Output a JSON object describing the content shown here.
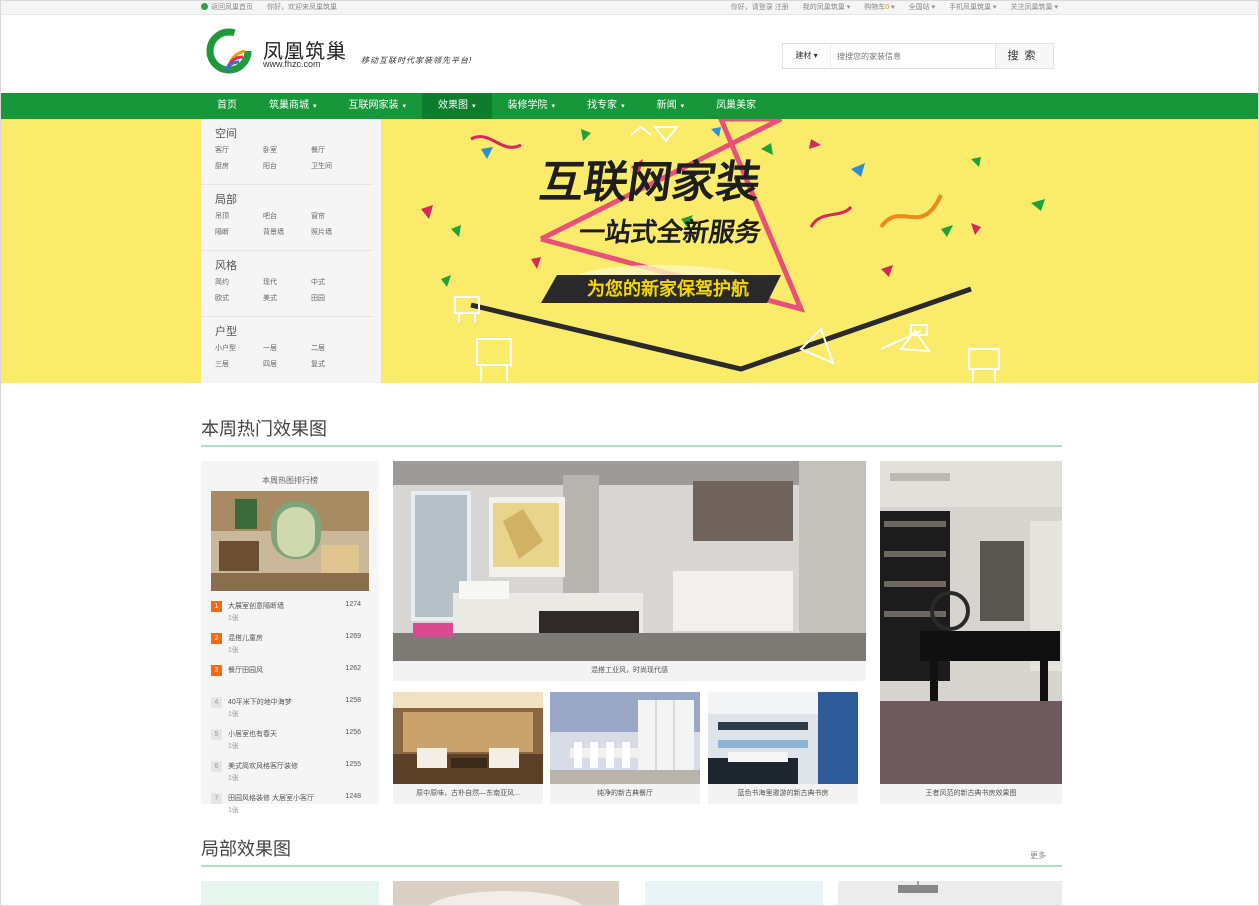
{
  "topbar": {
    "home": "返回凤巢首页",
    "welcome": "你好，欢迎来凤巢筑巢",
    "login": "你好，请登录",
    "register": "注册",
    "my": "我的凤巢筑巢",
    "cart": "购物车",
    "cart_count": "0",
    "sites": "全国站",
    "mobile": "手机凤巢筑巢",
    "follow": "关注凤巢筑巢"
  },
  "header": {
    "logo_name": "凤凰筑巢",
    "logo_url": "www.fhzc.com",
    "slogan": "移动互联时代家装领先平台!",
    "search_category": "建材",
    "search_placeholder": "搜搜您的家装信息",
    "search_button": "搜索"
  },
  "nav": [
    {
      "label": "首页",
      "caret": false
    },
    {
      "label": "筑巢商城",
      "caret": true
    },
    {
      "label": "互联网家装",
      "caret": true
    },
    {
      "label": "效果图",
      "caret": true,
      "active": true
    },
    {
      "label": "装修学院",
      "caret": true
    },
    {
      "label": "找专家",
      "caret": true
    },
    {
      "label": "新闻",
      "caret": true
    },
    {
      "label": "凤巢美家",
      "caret": false
    }
  ],
  "categories": [
    {
      "title": "空间",
      "items": [
        "客厅",
        "卧室",
        "餐厅",
        "厨房",
        "阳台",
        "卫生间"
      ]
    },
    {
      "title": "局部",
      "items": [
        "吊顶",
        "吧台",
        "窗帘",
        "隔断",
        "背景墙",
        "照片墙"
      ]
    },
    {
      "title": "风格",
      "items": [
        "简约",
        "现代",
        "中式",
        "欧式",
        "美式",
        "田园"
      ]
    },
    {
      "title": "户型",
      "items": [
        "小户型",
        "一居",
        "二居",
        "三居",
        "四居",
        "复式"
      ]
    }
  ],
  "banner": {
    "headline": "互联网家装",
    "subline": "一站式全新服务",
    "tagline": "为您的新家保驾护航",
    "bg": "#faeb6a"
  },
  "section_hot": {
    "title": "本周热门效果图",
    "ranking_title": "本周热图排行榜",
    "ranking": [
      {
        "rank": "1",
        "name": "大展室创意隔断墙",
        "count": "1274",
        "sub": "1张"
      },
      {
        "rank": "2",
        "name": "混搭儿童房",
        "count": "1269",
        "sub": "1张"
      },
      {
        "rank": "3",
        "name": "餐厅田园风",
        "count": "1262",
        "sub": ""
      },
      {
        "rank": "4",
        "name": "40平米下的地中海梦",
        "count": "1258",
        "sub": "1张"
      },
      {
        "rank": "5",
        "name": "小居室也有春天",
        "count": "1256",
        "sub": "1张"
      },
      {
        "rank": "6",
        "name": "美式简欢风格客厅装修",
        "count": "1255",
        "sub": "1张"
      },
      {
        "rank": "7",
        "name": "田园风格装修 大居室小客厅",
        "count": "1248",
        "sub": "1张"
      }
    ],
    "main_caption": "混搭工业风，时尚现代感",
    "right_caption": "王者风范的新古典书房效果图",
    "small_captions": [
      "原中原味，古朴自然—东南亚风...",
      "纯净的新古典餐厅",
      "蓝色书海里邀游的新古典书房"
    ]
  },
  "section_local": {
    "title": "局部效果图",
    "more": "更多"
  },
  "colors": {
    "brand_green": "#17963a",
    "accent_orange": "#f46a13"
  }
}
